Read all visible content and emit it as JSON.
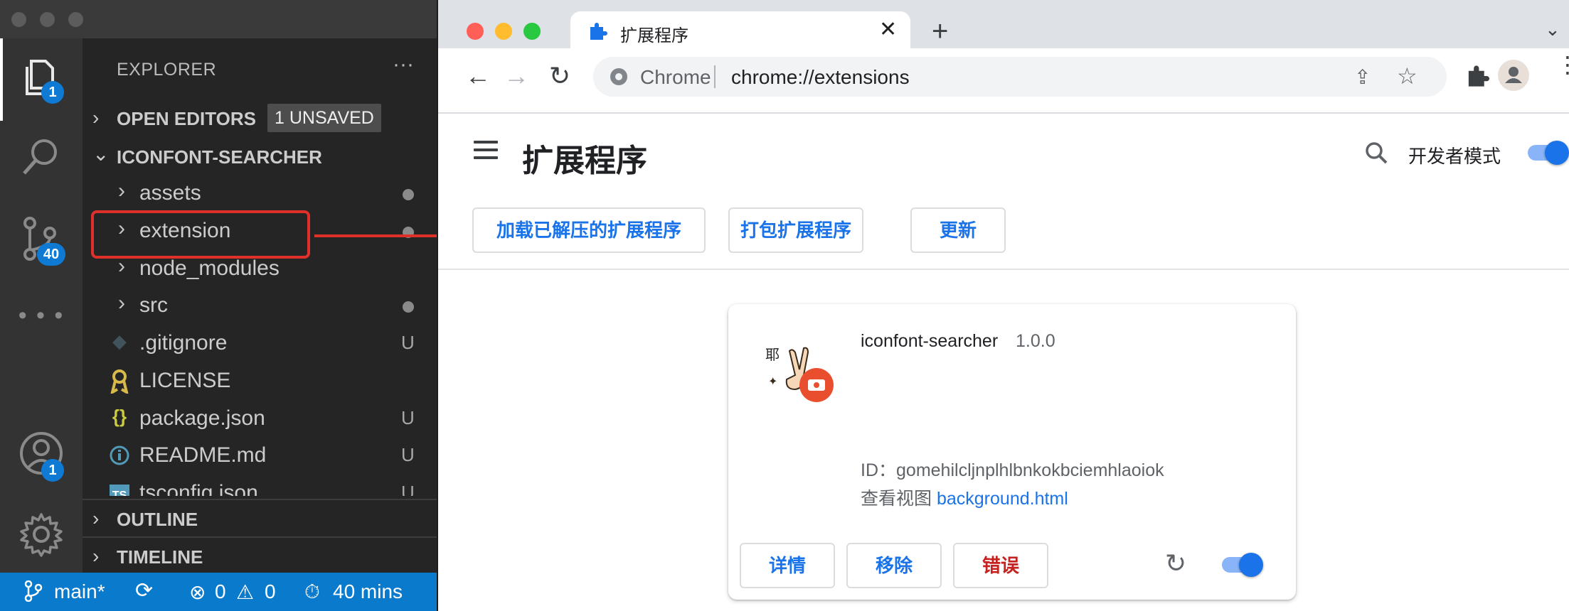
{
  "vscode": {
    "activity_badges": {
      "explorer": "1",
      "source_control": "40",
      "accounts": "1"
    },
    "explorer_title": "EXPLORER",
    "more_actions": "···",
    "open_editors": {
      "label": "OPEN EDITORS",
      "badge": "1 UNSAVED"
    },
    "workspace": "ICONFONT-SEARCHER",
    "tree": [
      {
        "name": "assets",
        "kind": "folder",
        "status": "dot"
      },
      {
        "name": "extension",
        "kind": "folder",
        "status": "dot"
      },
      {
        "name": "node_modules",
        "kind": "folder",
        "status": ""
      },
      {
        "name": "src",
        "kind": "folder",
        "status": "dot"
      },
      {
        "name": ".gitignore",
        "kind": "git-icon",
        "status": "U"
      },
      {
        "name": "LICENSE",
        "kind": "license-icon",
        "status": ""
      },
      {
        "name": "package.json",
        "kind": "json-icon",
        "status": "U"
      },
      {
        "name": "README.md",
        "kind": "info-icon",
        "status": "U"
      },
      {
        "name": "tsconfig.json",
        "kind": "ts-icon",
        "status": "U"
      }
    ],
    "outline": "OUTLINE",
    "timeline": "TIMELINE",
    "status": {
      "branch": "main*",
      "errors": "0",
      "warnings": "0",
      "time": "40 mins"
    }
  },
  "chrome": {
    "tab_title": "扩展程序",
    "tab_close": "✕",
    "new_tab": "+",
    "omnibox_label": "Chrome",
    "url": "chrome://extensions",
    "page_title": "扩展程序",
    "dev_mode_label": "开发者模式",
    "buttons": {
      "load_unpacked": "加载已解压的扩展程序",
      "pack": "打包扩展程序",
      "update": "更新"
    },
    "extension": {
      "name": "iconfont-searcher",
      "version": "1.0.0",
      "id_label": "ID：",
      "id": "gomehilcljnplhlbnkokbciemhlaoiok",
      "views_label": "查看视图",
      "views_link": "background.html",
      "details": "详情",
      "remove": "移除",
      "errors": "错误",
      "enabled": true
    }
  },
  "colors": {
    "accent": "#1a73e8",
    "error_text": "#c5221f",
    "highlight": "#e0302a",
    "statusbar": "#0a7acc"
  }
}
